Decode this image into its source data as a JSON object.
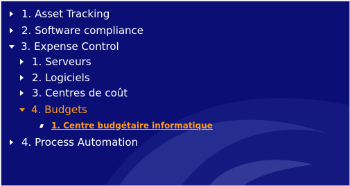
{
  "nav": {
    "items": [
      {
        "label": "1. Asset Tracking",
        "expanded": false
      },
      {
        "label": "2. Software compliance",
        "expanded": false
      },
      {
        "label": "3. Expense Control",
        "expanded": true
      },
      {
        "label": "1. Serveurs",
        "expanded": false
      },
      {
        "label": "2. Logiciels",
        "expanded": false
      },
      {
        "label": "3. Centres de coût",
        "expanded": false
      },
      {
        "label": "4. Budgets",
        "expanded": true,
        "active": true
      },
      {
        "label": "1. Centre budgétaire informatique",
        "selected": true
      },
      {
        "label": "4. Process Automation",
        "expanded": false
      }
    ]
  },
  "colors": {
    "background": "#0b0f75",
    "text": "#ffffff",
    "accent": "#ff9a1a",
    "border": "#b9b9b9"
  }
}
